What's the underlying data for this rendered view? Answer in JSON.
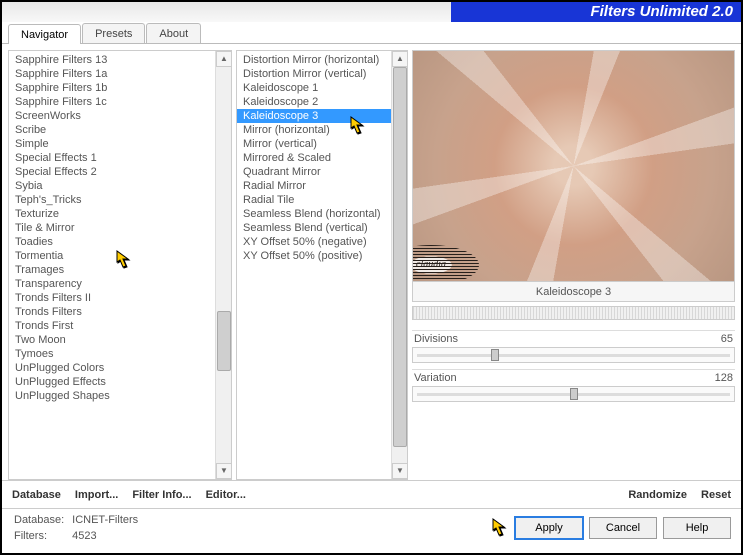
{
  "app_title": "Filters Unlimited 2.0",
  "tabs": [
    "Navigator",
    "Presets",
    "About"
  ],
  "active_tab": 0,
  "left_list": [
    "Sapphire Filters 13",
    "Sapphire Filters 1a",
    "Sapphire Filters 1b",
    "Sapphire Filters 1c",
    "ScreenWorks",
    "Scribe",
    "Simple",
    "Special Effects 1",
    "Special Effects 2",
    "Sybia",
    "Teph's_Tricks",
    "Texturize",
    "Tile & Mirror",
    "Toadies",
    "Tormentia",
    "Tramages",
    "Transparency",
    "Tronds Filters II",
    "Tronds Filters",
    "Tronds First",
    "Two Moon",
    "Tymoes",
    "UnPlugged Colors",
    "UnPlugged Effects",
    "UnPlugged Shapes"
  ],
  "left_selected_index": 12,
  "mid_list": [
    "Distortion Mirror (horizontal)",
    "Distortion Mirror (vertical)",
    "Kaleidoscope 1",
    "Kaleidoscope 2",
    "Kaleidoscope 3",
    "Mirror (horizontal)",
    "Mirror (vertical)",
    "Mirrored & Scaled",
    "Quadrant Mirror",
    "Radial Mirror",
    "Radial Tile",
    "Seamless Blend (horizontal)",
    "Seamless Blend (vertical)",
    "XY Offset 50% (negative)",
    "XY Offset 50% (positive)"
  ],
  "mid_selected_index": 4,
  "filter_name": "Kaleidoscope 3",
  "watermark_text": "claudia",
  "params": [
    {
      "name": "Divisions",
      "value": 65,
      "max": 255
    },
    {
      "name": "Variation",
      "value": 128,
      "max": 255
    }
  ],
  "row1_buttons": [
    "Database",
    "Import...",
    "Filter Info...",
    "Editor...",
    "Randomize",
    "Reset"
  ],
  "footer": {
    "db_label": "Database:",
    "db_value": "ICNET-Filters",
    "filters_label": "Filters:",
    "filters_value": "4523",
    "buttons": [
      "Apply",
      "Cancel",
      "Help"
    ]
  }
}
